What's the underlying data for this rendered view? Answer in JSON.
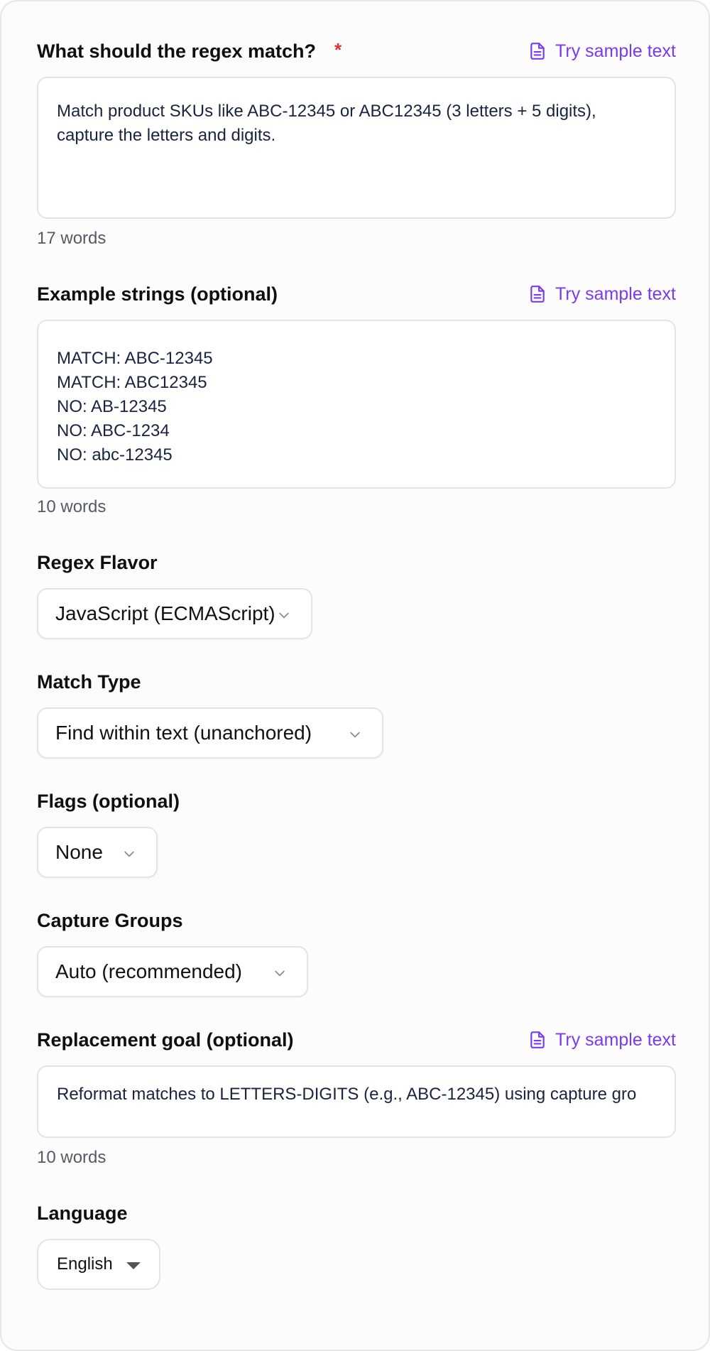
{
  "colors": {
    "accent": "#7c3aed",
    "required": "#e03131",
    "text": "#0f0f10",
    "muted": "#555b65",
    "input_text": "#1a2340",
    "border": "#e3e4e8"
  },
  "regex_match": {
    "label": "What should the regex match?",
    "required_mark": "*",
    "sample_button": "Try sample text",
    "sample_icon": "file-text-icon",
    "value": "Match product SKUs like ABC-12345 or ABC12345 (3 letters + 5 digits), capture the letters and digits.",
    "word_count": "17 words"
  },
  "examples": {
    "label": "Example strings (optional)",
    "sample_button": "Try sample text",
    "sample_icon": "file-text-icon",
    "value": "MATCH: ABC-12345\nMATCH: ABC12345\nNO: AB-12345\nNO: ABC-1234\nNO: abc-12345",
    "word_count": "10 words"
  },
  "regex_flavor": {
    "label": "Regex Flavor",
    "selected": "JavaScript (ECMAScript)",
    "icon": "chevron-down-icon"
  },
  "match_type": {
    "label": "Match Type",
    "selected": "Find within text (unanchored)",
    "icon": "chevron-down-icon"
  },
  "flags": {
    "label": "Flags (optional)",
    "selected": "None",
    "icon": "chevron-down-icon"
  },
  "capture_groups": {
    "label": "Capture Groups",
    "selected": "Auto (recommended)",
    "icon": "chevron-down-icon"
  },
  "replacement": {
    "label": "Replacement goal (optional)",
    "sample_button": "Try sample text",
    "sample_icon": "file-text-icon",
    "value": "Reformat matches to LETTERS-DIGITS (e.g., ABC-12345) using capture gro",
    "word_count": "10 words"
  },
  "language": {
    "label": "Language",
    "selected": "English",
    "icon": "caret-down-icon"
  }
}
